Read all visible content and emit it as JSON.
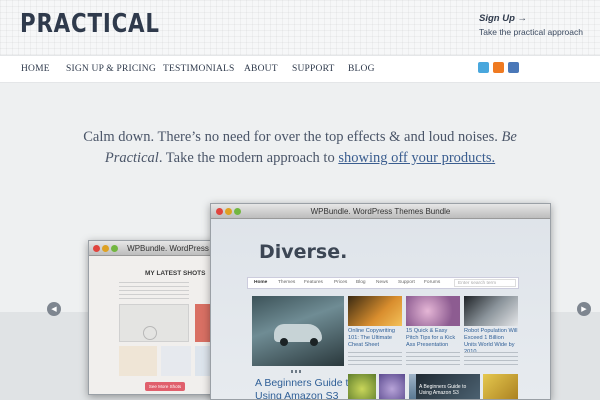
{
  "site": {
    "logo": "PRACTICAL",
    "signup": "Sign Up →",
    "tagline": "Take the practical approach"
  },
  "nav": {
    "items": [
      "HOME",
      "SIGN UP & PRICING",
      "TESTIMONIALS",
      "ABOUT",
      "SUPPORT",
      "BLOG"
    ]
  },
  "social": {
    "icons": [
      "twitter-icon",
      "rss-icon",
      "facebook-icon"
    ],
    "colors": [
      "#49a7dd",
      "#ef7a21",
      "#4a78b8"
    ]
  },
  "hero": {
    "part1": "Calm down. There’s no need for over the top effects & and loud noises.",
    "em": "Be Practical",
    "part2": ". Take the modern approach to",
    "link": "showing off your products."
  },
  "slider": {
    "prev_icon": "arrow-left-icon",
    "next_icon": "arrow-right-icon"
  },
  "back_window": {
    "title": "WPBundle. WordPress",
    "heading": "MY LATEST SHOTS",
    "button": "See More Shots"
  },
  "front_window": {
    "title": "WPBundle. WordPress Themes Bundle",
    "brand": "Diverse.",
    "menu": [
      "Home",
      "Themes",
      "Features",
      "Prices",
      "Blog",
      "News",
      "Support",
      "Forums"
    ],
    "search_placeholder": "Enter search term",
    "cards": [
      "Online Copywriting 101: The Ultimate Cheat Sheet",
      "15 Quick & Easy Pitch Tips for a Kick Ass Presentation",
      "Robot Population Will Exceed 1 Billion Units World Wide by 2010"
    ],
    "featured": "A Beginners Guide to Using Amazon S3",
    "feature_caption": "A Beginners Guide to Using Amazon S3"
  }
}
